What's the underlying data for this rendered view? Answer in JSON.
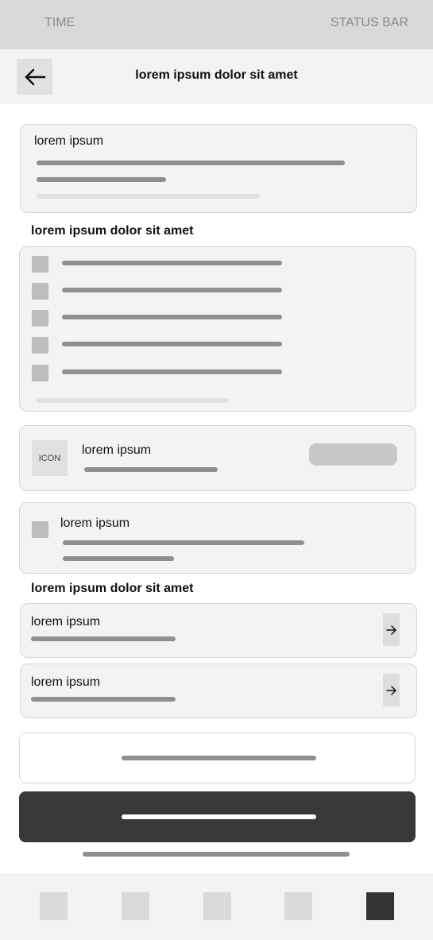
{
  "status_bar": {
    "time": "TIME",
    "status": "STATUS BAR"
  },
  "header": {
    "title": "lorem ipsum dolor sit amet",
    "back_icon": "arrow-left-icon"
  },
  "summary_card": {
    "title": "lorem ipsum"
  },
  "checklist": {
    "title": "lorem ipsum dolor sit amet",
    "items": [
      {
        "checked": false
      },
      {
        "checked": false
      },
      {
        "checked": false
      },
      {
        "checked": false
      },
      {
        "checked": false
      }
    ]
  },
  "icon_card": {
    "icon_label": "ICON",
    "title": "lorem ipsum"
  },
  "checkbox_card": {
    "title": "lorem ipsum"
  },
  "links": {
    "title": "lorem ipsum dolor sit amet",
    "items": [
      {
        "title": "lorem ipsum",
        "icon": "arrow-right-icon"
      },
      {
        "title": "lorem ipsum",
        "icon": "arrow-right-icon"
      }
    ]
  },
  "tabs": [
    {
      "name": "tab-1",
      "active": false
    },
    {
      "name": "tab-2",
      "active": false
    },
    {
      "name": "tab-3",
      "active": false
    },
    {
      "name": "tab-4",
      "active": false
    },
    {
      "name": "tab-5",
      "active": true
    }
  ],
  "colors": {
    "primary_button": "#383838",
    "active_tab": "#333333",
    "placeholder_line": "#8f8f8f"
  }
}
